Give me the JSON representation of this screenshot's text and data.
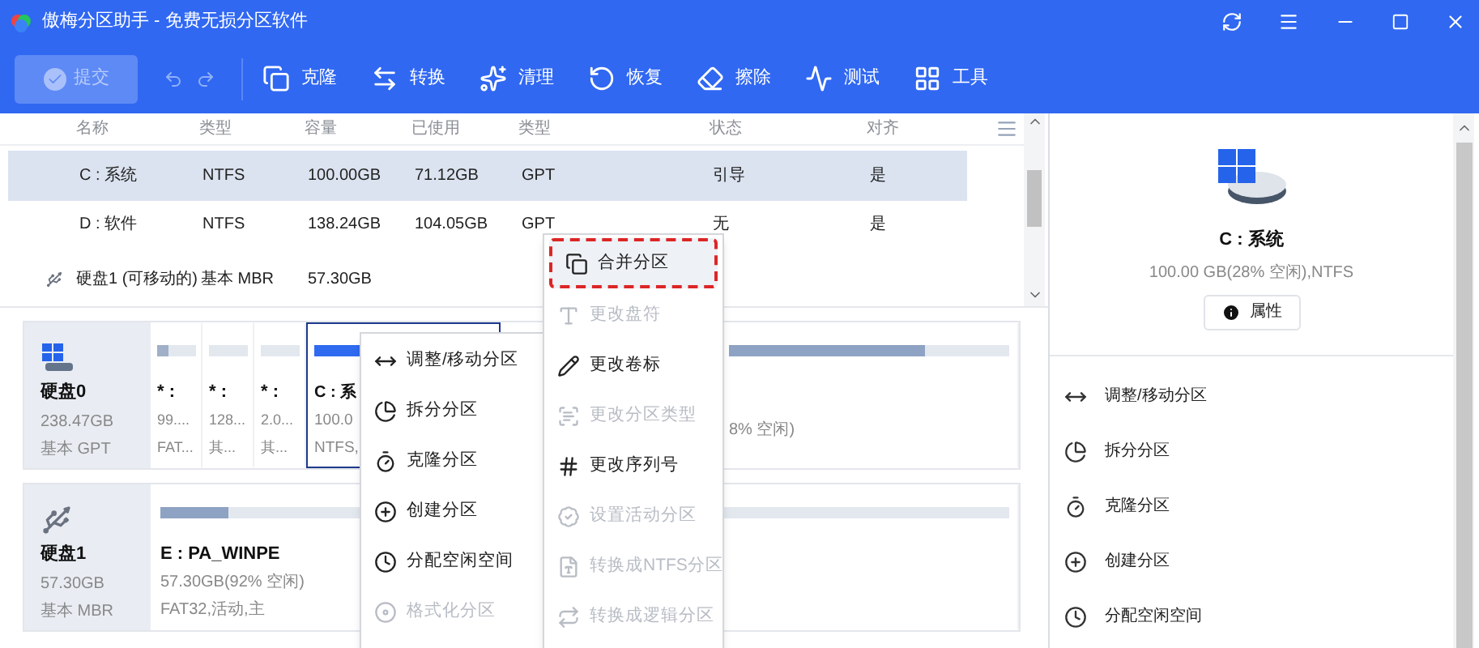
{
  "window": {
    "title": "傲梅分区助手 - 免费无损分区软件"
  },
  "toolbar": {
    "submit": {
      "label": "提交",
      "disabled": true
    },
    "undo_disabled": true,
    "items": [
      {
        "label": "克隆",
        "kind": "clone"
      },
      {
        "label": "转换",
        "kind": "convert"
      },
      {
        "label": "清理",
        "kind": "clean"
      },
      {
        "label": "恢复",
        "kind": "recover"
      },
      {
        "label": "擦除",
        "kind": "wipe"
      },
      {
        "label": "测试",
        "kind": "test"
      },
      {
        "label": "工具",
        "kind": "tools"
      }
    ]
  },
  "table": {
    "columns": [
      "名称",
      "类型",
      "容量",
      "已使用",
      "类型",
      "状态",
      "对齐"
    ],
    "rows": [
      {
        "cells": [
          "C : 系统",
          "NTFS",
          "100.00GB",
          "71.12GB",
          "GPT",
          "引导",
          "是"
        ],
        "selected": true
      },
      {
        "cells": [
          "D : 软件",
          "NTFS",
          "138.24GB",
          "104.05GB",
          "GPT",
          "无",
          "是"
        ],
        "selected": false
      }
    ],
    "disk_row": {
      "name": "硬盘1 (可移动的)",
      "type": "基本 MBR",
      "capacity": "57.30GB"
    }
  },
  "disks": [
    {
      "name": "硬盘0",
      "size": "238.47GB",
      "style": "基本 GPT",
      "kind": "system",
      "partitions": [
        {
          "name": "* :",
          "size": "99....",
          "fs": "FAT...",
          "level": 0.3,
          "selected": false,
          "kind": "small"
        },
        {
          "name": "* :",
          "size": "128...",
          "fs": "其...",
          "selected": false,
          "kind": "small"
        },
        {
          "name": "* :",
          "size": "2.0...",
          "fs": "其...",
          "selected": false,
          "kind": "small"
        },
        {
          "name": "C : 系",
          "size": "100.0",
          "fs": "NTFS,",
          "level": 0.9,
          "selected": true,
          "kind": "system"
        },
        {
          "size": "8% 空闲)",
          "level": 0.7,
          "selected": false,
          "kind": "data"
        }
      ]
    },
    {
      "name": "硬盘1",
      "size": "57.30GB",
      "style": "基本 MBR",
      "kind": "usb",
      "partitions": [
        {
          "name": "E : PA_WINPE",
          "size": "57.30GB(92% 空闲)",
          "fs": "FAT32,活动,主",
          "level": 0.08,
          "selected": false,
          "kind": "wide"
        }
      ]
    }
  ],
  "context_menu": {
    "items": [
      {
        "label": "调整/移动分区",
        "kind": "resize",
        "disabled": false
      },
      {
        "label": "拆分分区",
        "kind": "split",
        "disabled": false
      },
      {
        "label": "克隆分区",
        "kind": "clone",
        "disabled": false
      },
      {
        "label": "创建分区",
        "kind": "create",
        "disabled": false
      },
      {
        "label": "分配空闲空间",
        "kind": "allocate",
        "disabled": false
      },
      {
        "label": "格式化分区",
        "kind": "format",
        "disabled": true
      }
    ]
  },
  "submenu": {
    "items": [
      {
        "label": "合并分区",
        "kind": "merge",
        "disabled": false,
        "highlighted": true
      },
      {
        "label": "更改盘符",
        "kind": "letter",
        "disabled": true,
        "highlighted": false
      },
      {
        "label": "更改卷标",
        "kind": "label",
        "disabled": false,
        "highlighted": false
      },
      {
        "label": "更改分区类型",
        "kind": "type",
        "disabled": true,
        "highlighted": false
      },
      {
        "label": "更改序列号",
        "kind": "serial",
        "disabled": false,
        "highlighted": false
      },
      {
        "label": "设置活动分区",
        "kind": "active",
        "disabled": true,
        "highlighted": false
      },
      {
        "label": "转换成NTFS分区",
        "kind": "ntfs",
        "disabled": true,
        "highlighted": false
      },
      {
        "label": "转换成逻辑分区",
        "kind": "logical",
        "disabled": true,
        "highlighted": false
      }
    ]
  },
  "details": {
    "title": "C : 系统",
    "info": "100.00 GB(28% 空闲),NTFS",
    "button": "属性",
    "actions": [
      {
        "label": "调整/移动分区",
        "kind": "resize"
      },
      {
        "label": "拆分分区",
        "kind": "split"
      },
      {
        "label": "克隆分区",
        "kind": "clone"
      },
      {
        "label": "创建分区",
        "kind": "create"
      },
      {
        "label": "分配空闲空间",
        "kind": "allocate"
      }
    ]
  }
}
